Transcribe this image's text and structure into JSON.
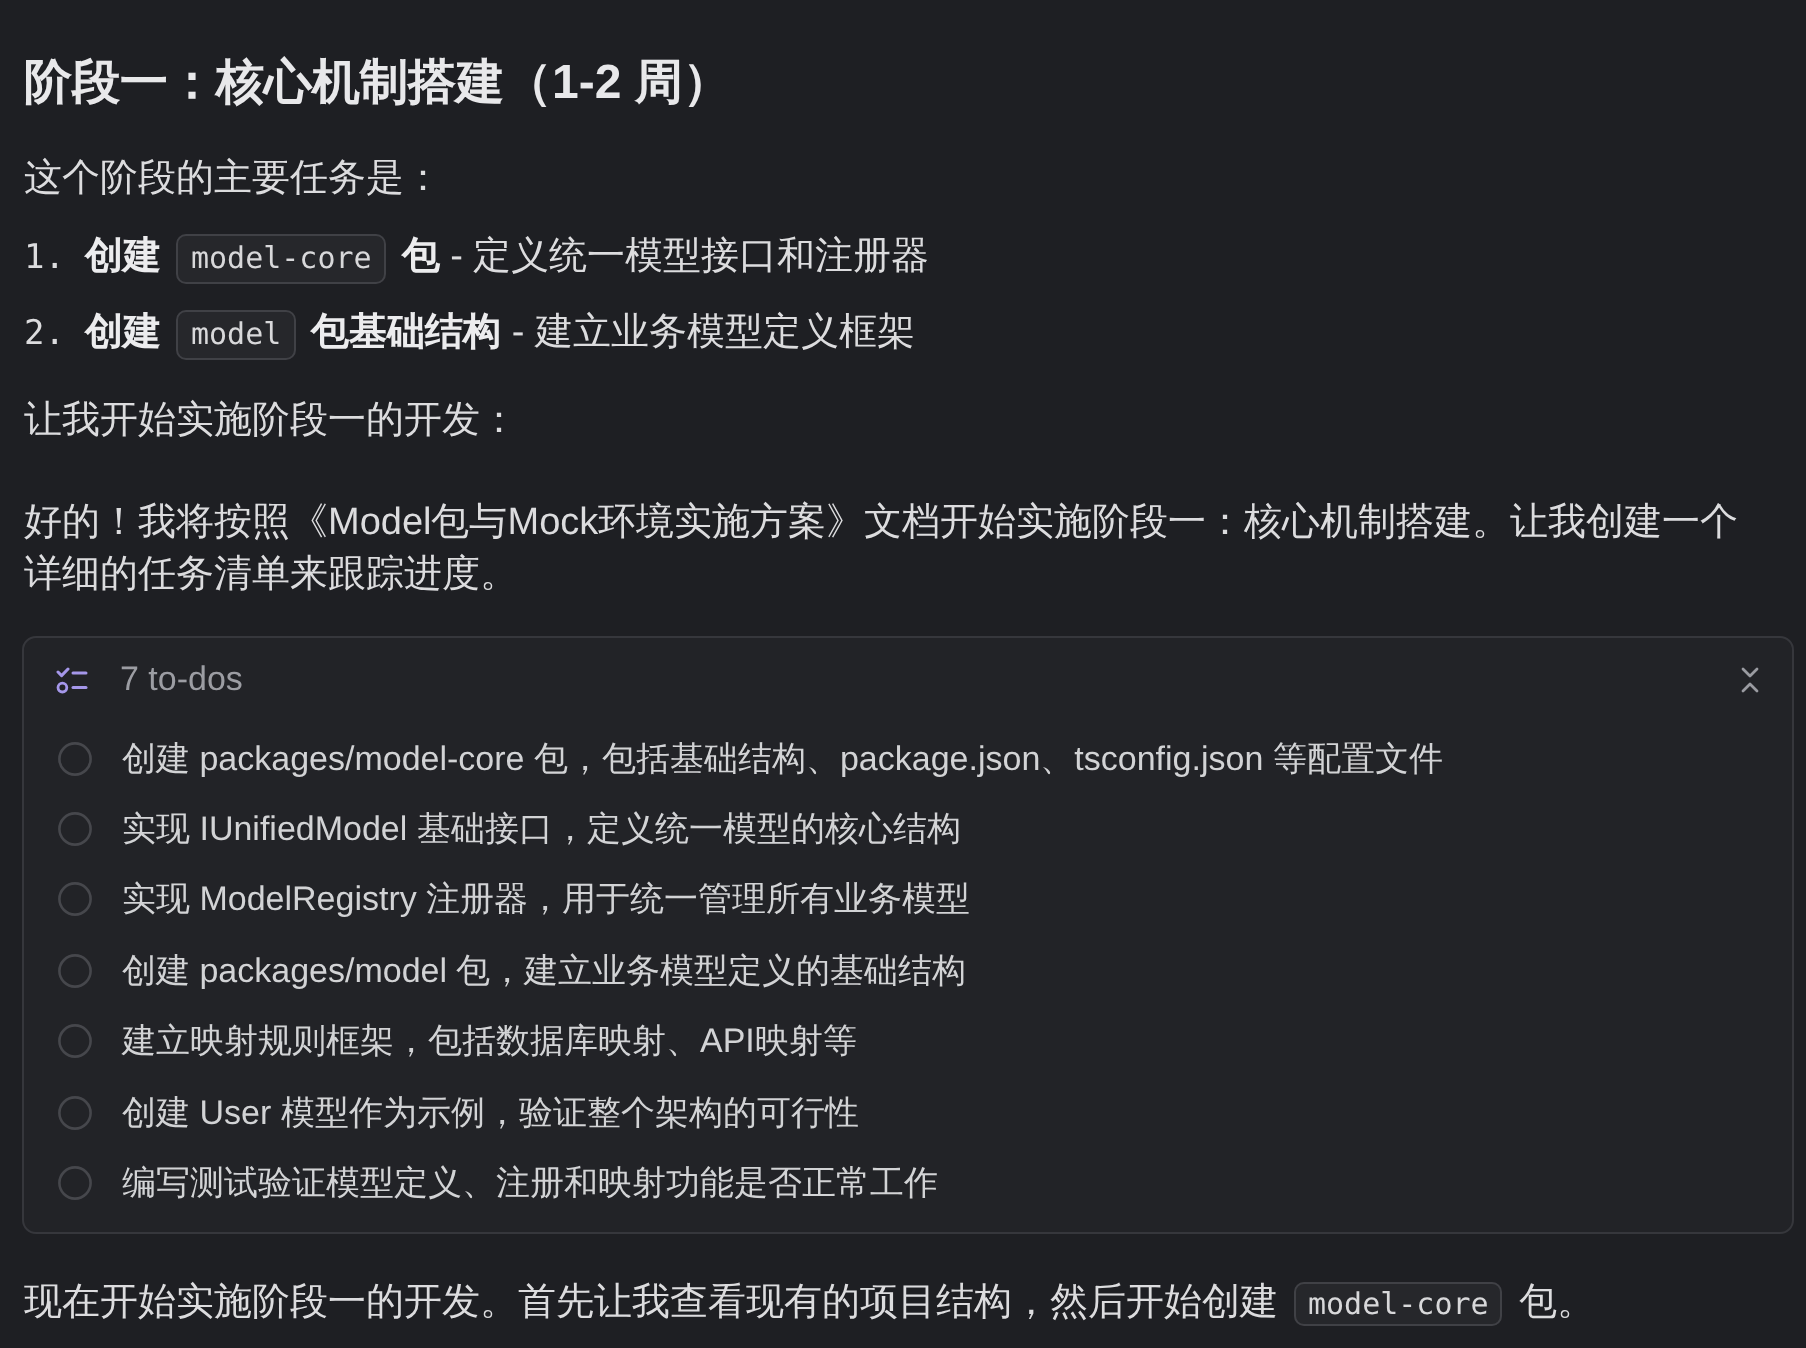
{
  "blocks": [
    {
      "kind": "heading",
      "text": "阶段一：核心机制搭建（1-2 周）"
    },
    {
      "kind": "paragraph",
      "segments": [
        {
          "kind": "text",
          "text": "这个阶段的主要任务是："
        }
      ]
    },
    {
      "kind": "list",
      "items": [
        {
          "number": "1.",
          "segments": [
            {
              "kind": "strong",
              "text": "创建"
            },
            {
              "kind": "code",
              "text": "model-core"
            },
            {
              "kind": "text",
              "text": "**包** - 定义统一模型接口和注册器"
            }
          ]
        },
        {
          "number": "2.",
          "segments": [
            {
              "kind": "strong",
              "text": "创建"
            },
            {
              "kind": "code",
              "text": "model"
            },
            {
              "kind": "text",
              "text": "**包基础结构** - 建立业务模型定义框架"
            }
          ]
        }
      ]
    },
    {
      "kind": "paragraph",
      "segments": [
        {
          "kind": "text",
          "text": "让我开始实施阶段一的开发："
        }
      ]
    },
    {
      "kind": "paragraph",
      "segments": [
        {
          "kind": "text",
          "text": "好的！我将按照《Model包与Mock环境实施方案》文档开始实施阶段一：核心机制搭建。让我创建一个详细的任务清单来跟踪进度。"
        }
      ]
    },
    {
      "kind": "todos",
      "title": "7 to-dos",
      "expanded": true,
      "items": [
        {
          "text": "创建 packages/model-core 包，包括基础结构、package.json、tsconfig.json 等配置文件",
          "checked": false
        },
        {
          "text": "实现 IUnifiedModel 基础接口，定义统一模型的核心结构",
          "checked": false
        },
        {
          "text": "实现 ModelRegistry 注册器，用于统一管理所有业务模型",
          "checked": false
        },
        {
          "text": "创建 packages/model 包，建立业务模型定义的基础结构",
          "checked": false
        },
        {
          "text": "建立映射规则框架，包括数据库映射、API映射等",
          "checked": false
        },
        {
          "text": "创建 User 模型作为示例，验证整个架构的可行性",
          "checked": false
        },
        {
          "text": "编写测试验证模型定义、注册和映射功能是否正常工作",
          "checked": false
        }
      ]
    },
    {
      "kind": "paragraph",
      "segments": [
        {
          "kind": "text",
          "text": "现在开始实施阶段一的开发。首先让我查看现有的项目结构，然后开始创建"
        },
        {
          "kind": "code",
          "text": "model-core"
        },
        {
          "kind": "text",
          "text": "包。"
        }
      ]
    }
  ]
}
